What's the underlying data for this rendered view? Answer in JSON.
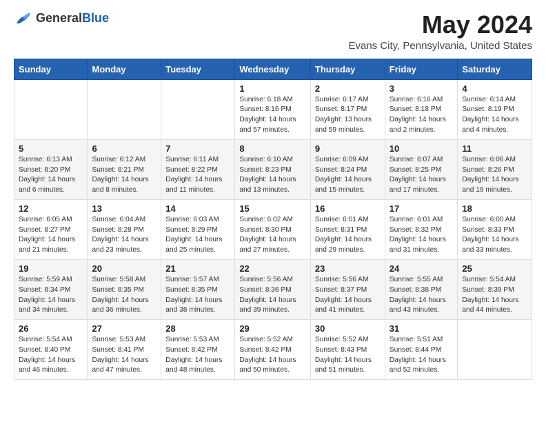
{
  "logo": {
    "text_general": "General",
    "text_blue": "Blue"
  },
  "title": "May 2024",
  "subtitle": "Evans City, Pennsylvania, United States",
  "days_of_week": [
    "Sunday",
    "Monday",
    "Tuesday",
    "Wednesday",
    "Thursday",
    "Friday",
    "Saturday"
  ],
  "weeks": [
    [
      {
        "day": "",
        "text": ""
      },
      {
        "day": "",
        "text": ""
      },
      {
        "day": "",
        "text": ""
      },
      {
        "day": "1",
        "text": "Sunrise: 6:18 AM\nSunset: 8:16 PM\nDaylight: 14 hours\nand 57 minutes."
      },
      {
        "day": "2",
        "text": "Sunrise: 6:17 AM\nSunset: 8:17 PM\nDaylight: 13 hours\nand 59 minutes."
      },
      {
        "day": "3",
        "text": "Sunrise: 6:16 AM\nSunset: 8:18 PM\nDaylight: 14 hours\nand 2 minutes."
      },
      {
        "day": "4",
        "text": "Sunrise: 6:14 AM\nSunset: 8:19 PM\nDaylight: 14 hours\nand 4 minutes."
      }
    ],
    [
      {
        "day": "5",
        "text": "Sunrise: 6:13 AM\nSunset: 8:20 PM\nDaylight: 14 hours\nand 6 minutes."
      },
      {
        "day": "6",
        "text": "Sunrise: 6:12 AM\nSunset: 8:21 PM\nDaylight: 14 hours\nand 8 minutes."
      },
      {
        "day": "7",
        "text": "Sunrise: 6:11 AM\nSunset: 8:22 PM\nDaylight: 14 hours\nand 11 minutes."
      },
      {
        "day": "8",
        "text": "Sunrise: 6:10 AM\nSunset: 8:23 PM\nDaylight: 14 hours\nand 13 minutes."
      },
      {
        "day": "9",
        "text": "Sunrise: 6:09 AM\nSunset: 8:24 PM\nDaylight: 14 hours\nand 15 minutes."
      },
      {
        "day": "10",
        "text": "Sunrise: 6:07 AM\nSunset: 8:25 PM\nDaylight: 14 hours\nand 17 minutes."
      },
      {
        "day": "11",
        "text": "Sunrise: 6:06 AM\nSunset: 8:26 PM\nDaylight: 14 hours\nand 19 minutes."
      }
    ],
    [
      {
        "day": "12",
        "text": "Sunrise: 6:05 AM\nSunset: 8:27 PM\nDaylight: 14 hours\nand 21 minutes."
      },
      {
        "day": "13",
        "text": "Sunrise: 6:04 AM\nSunset: 8:28 PM\nDaylight: 14 hours\nand 23 minutes."
      },
      {
        "day": "14",
        "text": "Sunrise: 6:03 AM\nSunset: 8:29 PM\nDaylight: 14 hours\nand 25 minutes."
      },
      {
        "day": "15",
        "text": "Sunrise: 6:02 AM\nSunset: 8:30 PM\nDaylight: 14 hours\nand 27 minutes."
      },
      {
        "day": "16",
        "text": "Sunrise: 6:01 AM\nSunset: 8:31 PM\nDaylight: 14 hours\nand 29 minutes."
      },
      {
        "day": "17",
        "text": "Sunrise: 6:01 AM\nSunset: 8:32 PM\nDaylight: 14 hours\nand 31 minutes."
      },
      {
        "day": "18",
        "text": "Sunrise: 6:00 AM\nSunset: 8:33 PM\nDaylight: 14 hours\nand 33 minutes."
      }
    ],
    [
      {
        "day": "19",
        "text": "Sunrise: 5:59 AM\nSunset: 8:34 PM\nDaylight: 14 hours\nand 34 minutes."
      },
      {
        "day": "20",
        "text": "Sunrise: 5:58 AM\nSunset: 8:35 PM\nDaylight: 14 hours\nand 36 minutes."
      },
      {
        "day": "21",
        "text": "Sunrise: 5:57 AM\nSunset: 8:35 PM\nDaylight: 14 hours\nand 38 minutes."
      },
      {
        "day": "22",
        "text": "Sunrise: 5:56 AM\nSunset: 8:36 PM\nDaylight: 14 hours\nand 39 minutes."
      },
      {
        "day": "23",
        "text": "Sunrise: 5:56 AM\nSunset: 8:37 PM\nDaylight: 14 hours\nand 41 minutes."
      },
      {
        "day": "24",
        "text": "Sunrise: 5:55 AM\nSunset: 8:38 PM\nDaylight: 14 hours\nand 43 minutes."
      },
      {
        "day": "25",
        "text": "Sunrise: 5:54 AM\nSunset: 8:39 PM\nDaylight: 14 hours\nand 44 minutes."
      }
    ],
    [
      {
        "day": "26",
        "text": "Sunrise: 5:54 AM\nSunset: 8:40 PM\nDaylight: 14 hours\nand 46 minutes."
      },
      {
        "day": "27",
        "text": "Sunrise: 5:53 AM\nSunset: 8:41 PM\nDaylight: 14 hours\nand 47 minutes."
      },
      {
        "day": "28",
        "text": "Sunrise: 5:53 AM\nSunset: 8:42 PM\nDaylight: 14 hours\nand 48 minutes."
      },
      {
        "day": "29",
        "text": "Sunrise: 5:52 AM\nSunset: 8:42 PM\nDaylight: 14 hours\nand 50 minutes."
      },
      {
        "day": "30",
        "text": "Sunrise: 5:52 AM\nSunset: 8:43 PM\nDaylight: 14 hours\nand 51 minutes."
      },
      {
        "day": "31",
        "text": "Sunrise: 5:51 AM\nSunset: 8:44 PM\nDaylight: 14 hours\nand 52 minutes."
      },
      {
        "day": "",
        "text": ""
      }
    ]
  ]
}
